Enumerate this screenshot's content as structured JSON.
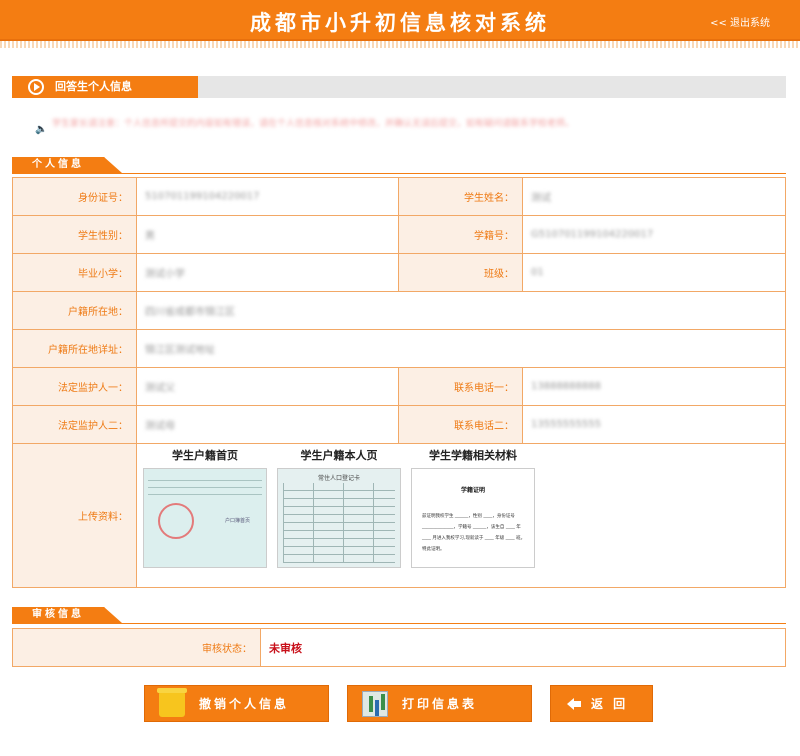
{
  "header": {
    "title": "成都市小升初信息核对系统",
    "logout_label": "<< 退出系统"
  },
  "section": {
    "title": "回答生个人信息"
  },
  "notice": {
    "text": "学生家长请注意：个人信息所提交的内容如有错误，请在个人信息核对系统中修改，并确认无误后提交，如有疑问请联系学校老师。"
  },
  "personal": {
    "heading": "个人信息",
    "labels": {
      "id_number": "身份证号：",
      "student_name": "学生姓名：",
      "gender": "学生性别：",
      "student_no": "学籍号：",
      "primary_school": "毕业小学：",
      "class": "班级：",
      "household_location": "户籍所在地：",
      "household_address": "户籍所在地详址：",
      "guardian1": "法定监护人一：",
      "phone1": "联系电话一：",
      "guardian2": "法定监护人二：",
      "phone2": "联系电话二：",
      "upload": "上传资料："
    },
    "values": {
      "id_number": "510701199104220017",
      "student_name": "测试",
      "gender": "男",
      "student_no": "G510701199104220017",
      "primary_school": "测试小学",
      "class": "01",
      "household_location": "四川省成都市锦江区",
      "household_address": "锦江区测试地址",
      "guardian1": "测试父",
      "phone1": "13888888888",
      "guardian2": "测试母",
      "phone2": "13555555555"
    }
  },
  "uploads": [
    {
      "caption": "学生户籍首页",
      "thumb_text": "户口簿首页"
    },
    {
      "caption": "学生户籍本人页",
      "thumb_text": "常住人口登记卡"
    },
    {
      "caption": "学生学籍相关材料",
      "thumb_text": "学籍证明",
      "body_text": "兹证明我校学生 ______，性别 ____，身份证号 ______________，学籍号 ______，该生自 ____ 年 ____ 月进入我校学习,现就读于 ____ 年级 ____ 班。特此证明。"
    }
  ],
  "audit": {
    "heading": "审核信息",
    "status_label": "审核状态：",
    "status_value": "未审核"
  },
  "buttons": {
    "revoke": "撤销个人信息",
    "print": "打印信息表",
    "back": "返 回"
  },
  "colors": {
    "accent": "#f47d12",
    "label_bg": "#fcefe4",
    "status": "#c8101a"
  }
}
